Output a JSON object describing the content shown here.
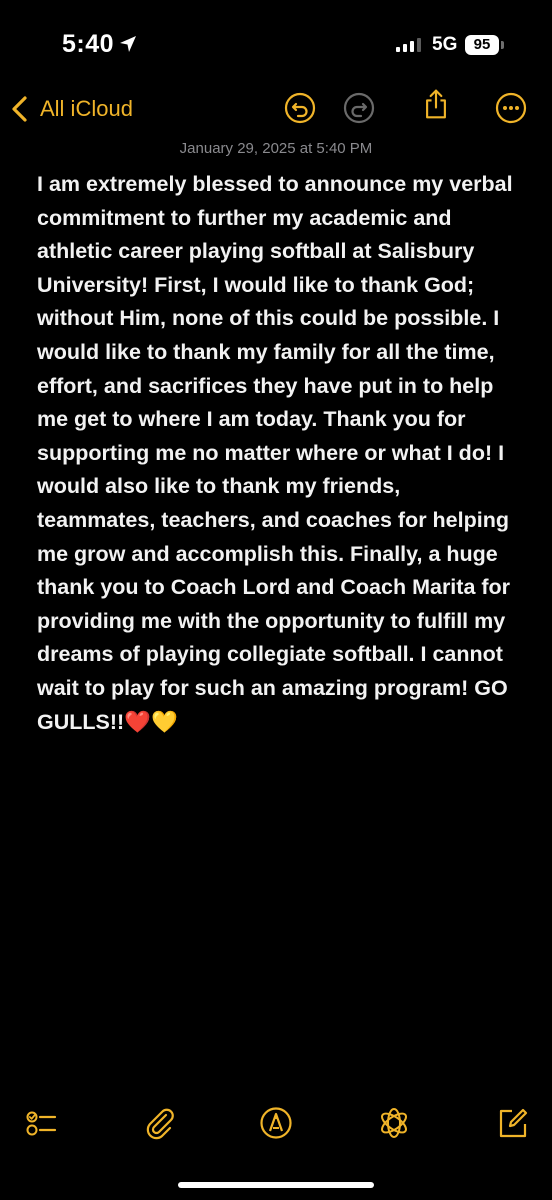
{
  "status_bar": {
    "time": "5:40",
    "network": "5G",
    "battery": "95"
  },
  "nav": {
    "back_label": "All iCloud"
  },
  "note": {
    "date": "January 29, 2025 at 5:40 PM",
    "body": "I am extremely blessed to announce my verbal commitment to further my academic and athletic career playing softball at Salisbury University! First, I would like to thank God; without Him, none of this could be possible. I would like to thank my family for all the time, effort, and sacrifices they have put in to help me get to where I am today. Thank you for supporting me no matter where or what I do! I would also like to thank my friends, teammates, teachers, and coaches for helping me grow and accomplish this. Finally, a huge thank you to Coach Lord and Coach Marita for providing me with the opportunity to fulfill my dreams of playing collegiate softball. I cannot wait to play for such an amazing program! GO GULLS!!❤️💛"
  },
  "colors": {
    "accent": "#f0b429",
    "background": "#000000",
    "date_text": "#8a8a8e"
  },
  "icons": {
    "nav": [
      "chevron-left-icon",
      "undo-icon",
      "redo-icon",
      "share-icon",
      "more-icon"
    ],
    "toolbar": [
      "checklist-icon",
      "paperclip-icon",
      "markup-icon",
      "apple-intelligence-icon",
      "compose-icon"
    ]
  }
}
